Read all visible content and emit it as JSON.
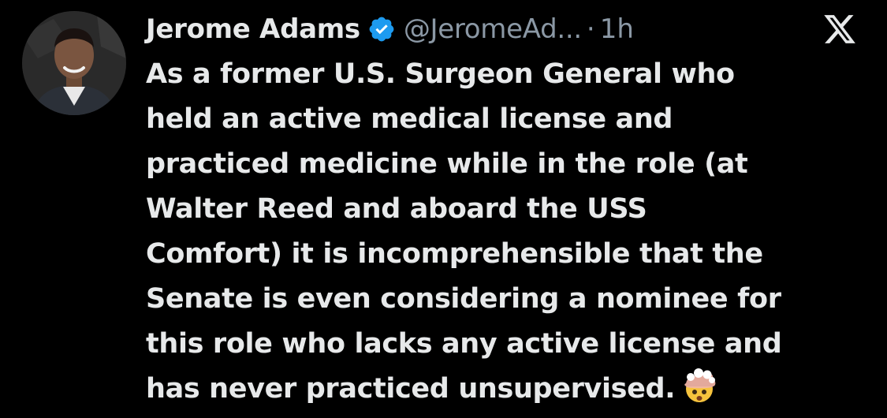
{
  "tweet": {
    "author": {
      "display_name": "Jerome Adams",
      "handle": "@JeromeAd...",
      "verified": true,
      "verified_color": "#1d9bf0"
    },
    "separator": "·",
    "timestamp": "1h",
    "text_lines": [
      "As a former U.S. Surgeon General who",
      "held an active medical license and",
      "practiced medicine while in the role (at",
      "Walter Reed and aboard the USS",
      "Comfort) it is incomprehensible that the",
      "Senate is even considering a nominee for",
      "this role who lacks any active license and",
      "has never practiced unsupervised."
    ],
    "emoji": "exploding-head-emoji"
  },
  "icons": {
    "brand_logo": "x-logo",
    "verified_badge": "verified-badge-icon"
  },
  "colors": {
    "background": "#000000",
    "text_primary": "#e7e9ea",
    "text_secondary": "#8b98a5",
    "accent": "#1d9bf0"
  }
}
